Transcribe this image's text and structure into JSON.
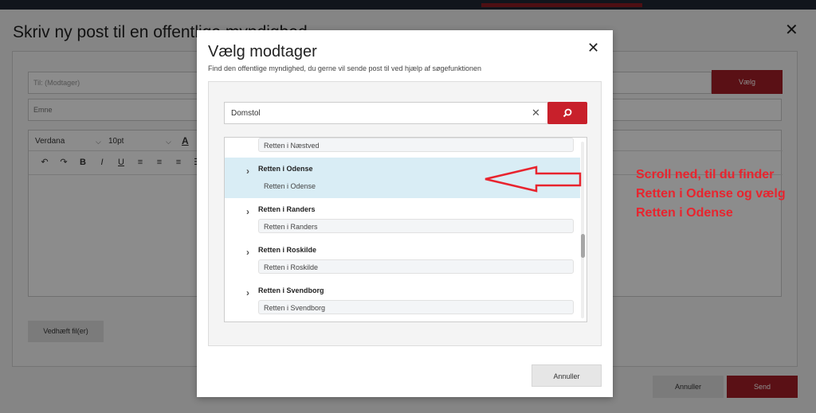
{
  "background_dialog": {
    "title": "Skriv ny post til en offentlige myndighed",
    "to_placeholder": "Til: (Modtager)",
    "choose_label": "Vælg",
    "subject_placeholder": "Emne",
    "editor": {
      "font": "Verdana",
      "size": "10pt"
    },
    "attach_label": "Vedhæft fil(er)",
    "cancel_label": "Annuller",
    "send_label": "Send"
  },
  "modal": {
    "title": "Vælg modtager",
    "subtitle": "Find den offentlige myndighed, du gerne vil sende post til ved hjælp af søgefunktionen",
    "search_value": "Domstol",
    "results": [
      {
        "name": "",
        "sub": "Retten i Næstved",
        "selected": false
      },
      {
        "name": "Retten i Odense",
        "sub": "Retten i Odense",
        "selected": true
      },
      {
        "name": "Retten i Randers",
        "sub": "Retten i Randers",
        "selected": false
      },
      {
        "name": "Retten i Roskilde",
        "sub": "Retten i Roskilde",
        "selected": false
      },
      {
        "name": "Retten i Svendborg",
        "sub": "Retten i Svendborg",
        "selected": false
      }
    ],
    "cancel_label": "Annuller"
  },
  "annotation": {
    "lines": [
      "Scroll ned, til du finder",
      "Retten  i Odense og vælg",
      "Retten i Odense"
    ],
    "color": "#e8242e"
  },
  "colors": {
    "accent_red": "#c8202b",
    "selected_row": "#d9edf5"
  }
}
